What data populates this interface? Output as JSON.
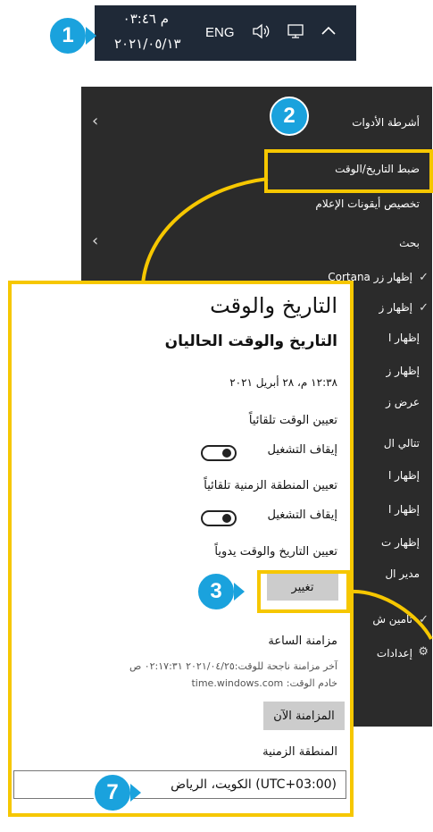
{
  "taskbar": {
    "time": "م ٠٣:٤٦",
    "date": "٢٠٢١/٠٥/١٣",
    "language": "ENG",
    "icons": [
      "speaker-icon",
      "network-icon",
      "chevron-up-icon"
    ]
  },
  "badges": {
    "b1": "1",
    "b2": "2",
    "b3": "3",
    "b7": "7"
  },
  "menu": {
    "items": [
      {
        "label": "أشرطة الأدوات"
      },
      {
        "label": "ضبط التاريخ/الوقت"
      },
      {
        "label": "تخصيص أيقونات الإعلام"
      },
      {
        "label": "بحث"
      },
      {
        "label": "إظهار زر Cortana"
      },
      {
        "label": "إظهار ز"
      },
      {
        "label": "إظهار ا"
      },
      {
        "label": "إظهار ز"
      },
      {
        "label": "عرض ز"
      },
      {
        "label": "تتالي ال"
      },
      {
        "label": "إظهار ا"
      },
      {
        "label": "إظهار ا"
      },
      {
        "label": "إظهار ت"
      },
      {
        "label": "مدير ال"
      },
      {
        "label": "تأمين ش"
      },
      {
        "label": "إعدادات"
      }
    ]
  },
  "panel": {
    "title": "التاريخ والوقت",
    "subtitle": "التاريخ والوقت الحاليان",
    "current_datetime": "١٢:٣٨ م، ٢٨ أبريل ٢٠٢١",
    "auto_time_label": "تعيين الوقت تلقائياً",
    "auto_time_state": "إيقاف التشغيل",
    "auto_tz_label": "تعيين المنطقة الزمنية تلقائياً",
    "auto_tz_state": "إيقاف التشغيل",
    "manual_label": "تعيين التاريخ والوقت يدوياً",
    "change_button": "تغيير",
    "sync_heading": "مزامنة الساعة",
    "last_sync": "آخر مزامنة ناجحة للوقت:٢٠٢١/٠٤/٢٥ ٠٢:١٧:٣١ ص",
    "time_server": "خادم الوقت: time.windows.com",
    "sync_button": "المزامنة الآن",
    "tz_heading": "المنطقة الزمنية",
    "tz_value": "(UTC+03:00) الكويت، الرياض"
  },
  "colors": {
    "highlight": "#f6c700",
    "badge": "#1aa2dd",
    "menu_bg": "#2b2b2b",
    "taskbar_bg": "#1f2937"
  }
}
